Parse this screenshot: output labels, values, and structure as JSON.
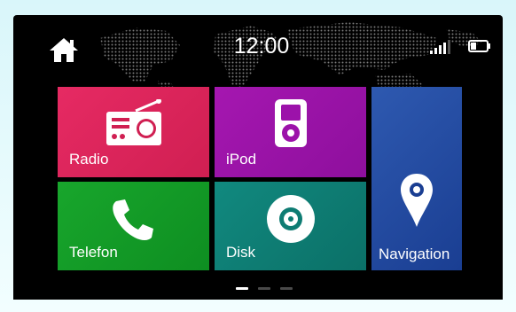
{
  "status_bar": {
    "time": "12:00",
    "home_icon": "home-icon",
    "signal_icon": "signal-icon",
    "battery_icon": "battery-icon"
  },
  "tiles": [
    {
      "label": "Radio",
      "icon": "radio-icon",
      "color": "#e0245e"
    },
    {
      "label": "iPod",
      "icon": "ipod-icon",
      "color": "#9c12aa"
    },
    {
      "label": "Telefon",
      "icon": "phone-icon",
      "color": "#139a27"
    },
    {
      "label": "Disk",
      "icon": "disc-icon",
      "color": "#0e7c73"
    },
    {
      "label": "Navigation",
      "icon": "location-pin-icon",
      "color": "#2449a0"
    }
  ],
  "pager": {
    "pages": 3,
    "current": 1
  }
}
